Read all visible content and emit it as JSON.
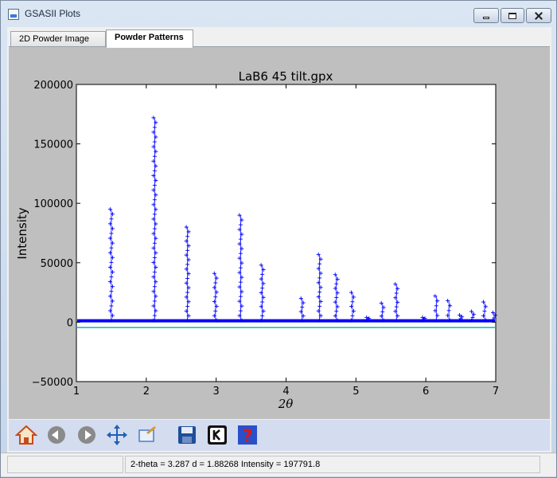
{
  "window": {
    "title": "GSASII Plots"
  },
  "tabs": [
    {
      "label": "2D Powder Image",
      "active": false
    },
    {
      "label": "Powder Patterns",
      "active": true
    }
  ],
  "plot": {
    "title": "LaB6 45 tilt.gpx",
    "xlabel": "2θ",
    "ylabel": "Intensity"
  },
  "chart_data": {
    "type": "scatter",
    "title": "LaB6 45 tilt.gpx",
    "xlabel": "2θ",
    "ylabel": "Intensity",
    "xlim": [
      1,
      7
    ],
    "ylim": [
      -50000,
      200000
    ],
    "x_ticks": [
      "1",
      "2",
      "3",
      "4",
      "5",
      "6",
      "7"
    ],
    "y_ticks": [
      "−50000",
      "0",
      "50000",
      "100000",
      "150000",
      "200000"
    ],
    "marker": "+",
    "series": [
      {
        "marker_color": "#0000ff",
        "background_level": 1500,
        "offset_line": -4500,
        "offset_line_color": "#00bcbc",
        "peaks": [
          {
            "x": 1.5,
            "y": 95000
          },
          {
            "x": 2.12,
            "y": 172000
          },
          {
            "x": 2.59,
            "y": 80000
          },
          {
            "x": 2.99,
            "y": 41000
          },
          {
            "x": 3.35,
            "y": 90000
          },
          {
            "x": 3.66,
            "y": 48000
          },
          {
            "x": 4.23,
            "y": 20000
          },
          {
            "x": 4.48,
            "y": 57000
          },
          {
            "x": 4.72,
            "y": 40000
          },
          {
            "x": 4.95,
            "y": 25000
          },
          {
            "x": 5.17,
            "y": 4000
          },
          {
            "x": 5.38,
            "y": 16000
          },
          {
            "x": 5.58,
            "y": 32000
          },
          {
            "x": 5.97,
            "y": 4000
          },
          {
            "x": 6.15,
            "y": 22000
          },
          {
            "x": 6.33,
            "y": 18000
          },
          {
            "x": 6.5,
            "y": 6000
          },
          {
            "x": 6.67,
            "y": 9000
          },
          {
            "x": 6.84,
            "y": 17000
          },
          {
            "x": 7.0,
            "y": 8000
          }
        ]
      }
    ],
    "grid": false
  },
  "toolbar": {
    "items": [
      {
        "name": "home-icon",
        "color": "#c84a1a"
      },
      {
        "name": "back-arrow-icon",
        "color": "#8a8a8a"
      },
      {
        "name": "forward-arrow-icon",
        "color": "#8a8a8a"
      },
      {
        "name": "pan-icon",
        "color": "#1f5fb8"
      },
      {
        "name": "zoom-icon",
        "color": "#4a7ec2"
      },
      {
        "name": "save-icon",
        "color": "#1e4f9a"
      },
      {
        "name": "key-icon",
        "color": "#111111"
      },
      {
        "name": "help-icon",
        "color": "#d81a1a"
      }
    ]
  },
  "status": {
    "left": "",
    "readout": "2-theta =    3.287 d =  1.88268 Intensity = 197791.8"
  }
}
